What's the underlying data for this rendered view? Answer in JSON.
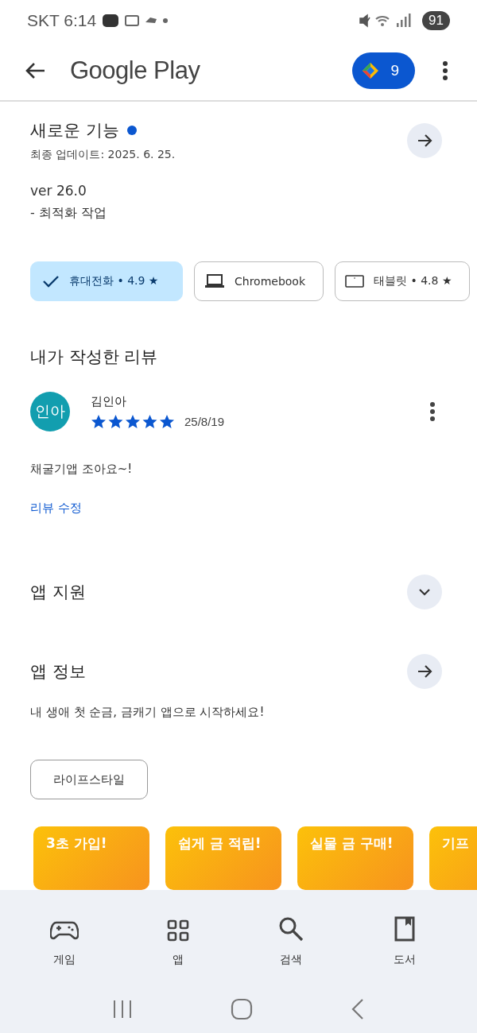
{
  "status_bar": {
    "carrier_time": "SKT 6:14",
    "battery": "91"
  },
  "app_bar": {
    "title": "Google Play",
    "points": "9"
  },
  "whats_new": {
    "title": "새로운 기능",
    "updated": "최종 업데이트: 2025. 6. 25.",
    "version": "ver 26.0",
    "notes": "- 최적화 작업"
  },
  "device_chips": [
    {
      "label": "휴대전화 • 4.9 ★",
      "selected": true
    },
    {
      "label": "Chromebook",
      "kind": "laptop",
      "selected": false
    },
    {
      "label": "태블릿 • 4.8 ★",
      "kind": "tablet",
      "selected": false
    }
  ],
  "my_review": {
    "heading": "내가 작성한 리뷰",
    "avatar": "인아",
    "author": "김인아",
    "stars": 5,
    "date": "25/8/19",
    "text": "채굴기앱 조아요~!",
    "edit_link": "리뷰 수정"
  },
  "app_support": {
    "title": "앱 지원",
    "expanded": false
  },
  "app_info": {
    "title": "앱 정보",
    "description": "내 생애 첫 순금, 금캐기 앱으로 시작하세요!",
    "category": "라이프스타일"
  },
  "screenshots": [
    {
      "caption": "3초 가입!"
    },
    {
      "caption": "쉽게 금 적립!"
    },
    {
      "caption": "실물 금 구매!"
    },
    {
      "caption": "기프"
    }
  ],
  "bottom_nav": [
    {
      "label": "게임",
      "kind": "games"
    },
    {
      "label": "앱",
      "kind": "apps"
    },
    {
      "label": "검색",
      "kind": "search"
    },
    {
      "label": "도서",
      "kind": "books"
    }
  ]
}
